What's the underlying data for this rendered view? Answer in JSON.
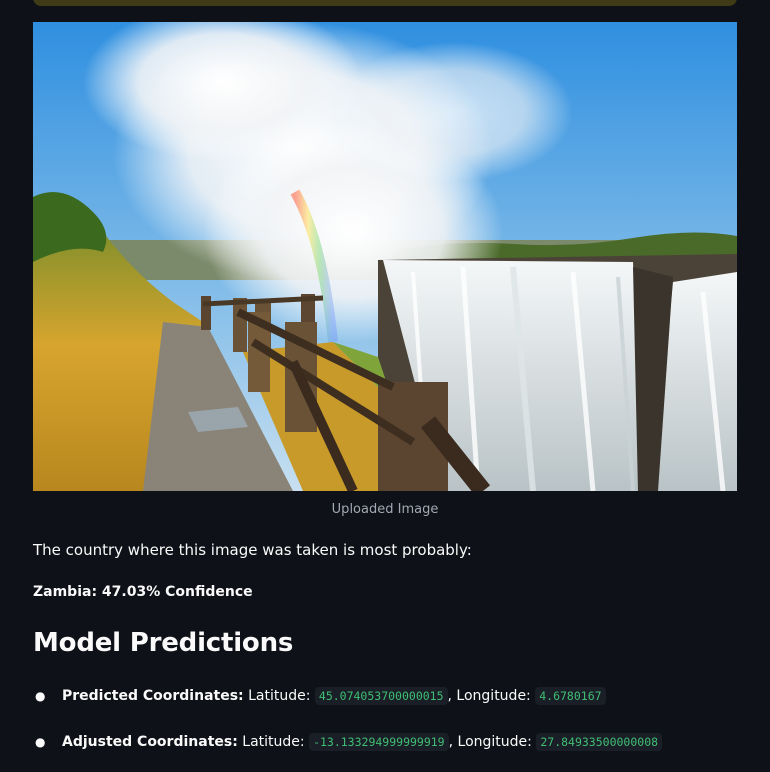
{
  "image": {
    "caption": "Uploaded Image",
    "subject": "waterfall-photo",
    "colors": {
      "sky_top": "#2f8fe0",
      "sky_bottom": "#bcd9ee",
      "mist": "#ffffff",
      "grass": "#d0a12c",
      "rock": "#5a4a38",
      "water": "#e8eef0"
    }
  },
  "result": {
    "intro_text": "The country where this image was taken is most probably:",
    "prediction_text": "Zambia: 47.03% Confidence"
  },
  "predictions": {
    "heading": "Model Predictions",
    "items": [
      {
        "label": "Predicted Coordinates:",
        "lat_label": "Latitude:",
        "lat_value": "45.074053700000015",
        "sep": ",",
        "lon_label": "Longitude:",
        "lon_value": "4.6780167"
      },
      {
        "label": "Adjusted Coordinates:",
        "lat_label": "Latitude:",
        "lat_value": "-13.133294999999919",
        "sep": ",",
        "lon_label": "Longitude:",
        "lon_value": "27.84933500000008"
      }
    ]
  },
  "colors": {
    "background": "#0e1117",
    "text": "#fafafa",
    "code_text": "#3fbf74",
    "code_bg": "#1a1e26",
    "banner": "#3e3b16"
  }
}
